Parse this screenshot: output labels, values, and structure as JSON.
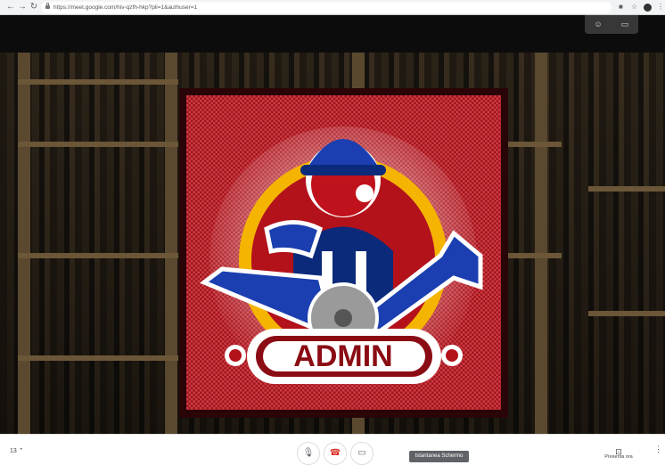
{
  "browser": {
    "url": "https://meet.google.com/hiv-qzfh-hkp?pli=1&authuser=1"
  },
  "meet": {
    "participant_count": "13",
    "tooltip": "Istantanea Schermo",
    "present_label": "Presenta ora",
    "presented_image_text": "ADMIN",
    "colors": {
      "mic": "#5f6368",
      "end_call": "#d93025",
      "camera": "#5f6368"
    }
  }
}
